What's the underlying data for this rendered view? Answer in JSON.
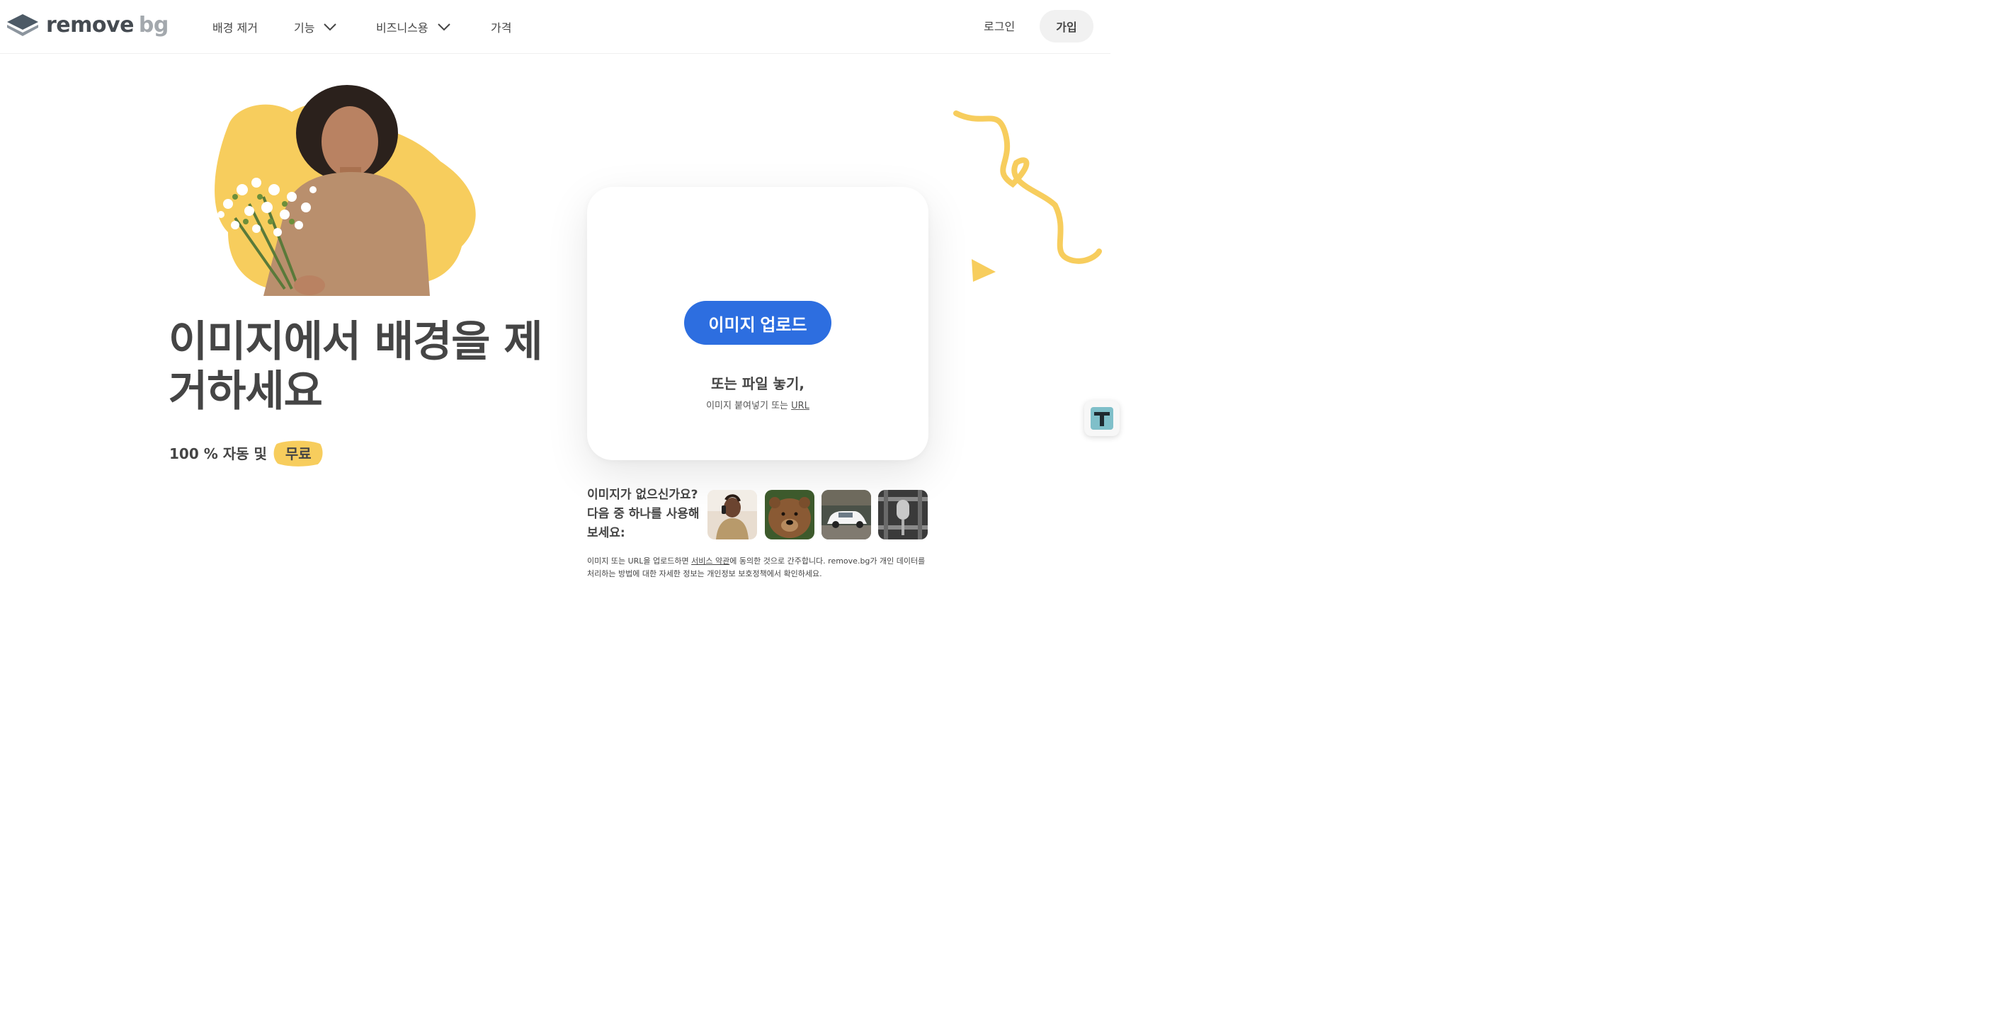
{
  "header": {
    "logo_main": "remove",
    "logo_suffix": "bg",
    "nav": {
      "remove_bg": "배경 제거",
      "features": "기능",
      "business": "비즈니스용",
      "pricing": "가격"
    },
    "login": "로그인",
    "signup": "가입"
  },
  "hero": {
    "title": "이미지에서 배경을 제거하세요",
    "subtitle_prefix": "100 % 자동 및",
    "subtitle_highlight": "무료"
  },
  "upload": {
    "button": "이미지 업로드",
    "drop_text": "또는 파일 놓기,",
    "paste_prefix": "이미지 붙여넣기 또는",
    "paste_link": "URL"
  },
  "samples": {
    "prompt": "이미지가 없으신가요? 다음 중 하나를 사용해 보세요:",
    "items": [
      "person-on-phone",
      "bear",
      "white-car",
      "microphone"
    ]
  },
  "legal": {
    "part1": "이미지 또는 URL을 업로드하면 ",
    "terms_link": "서비스 약관",
    "part2": "에 동의한 것으로 간주합니다. remove.bg가 개인 데이터를 처리하는 방법에 대한 자세한 정보는 개인정보 보호정책에서 확인하세요."
  },
  "colors": {
    "accent_blue": "#2d6ee0",
    "accent_yellow": "#f7cd5d",
    "text_dark": "#454545"
  }
}
